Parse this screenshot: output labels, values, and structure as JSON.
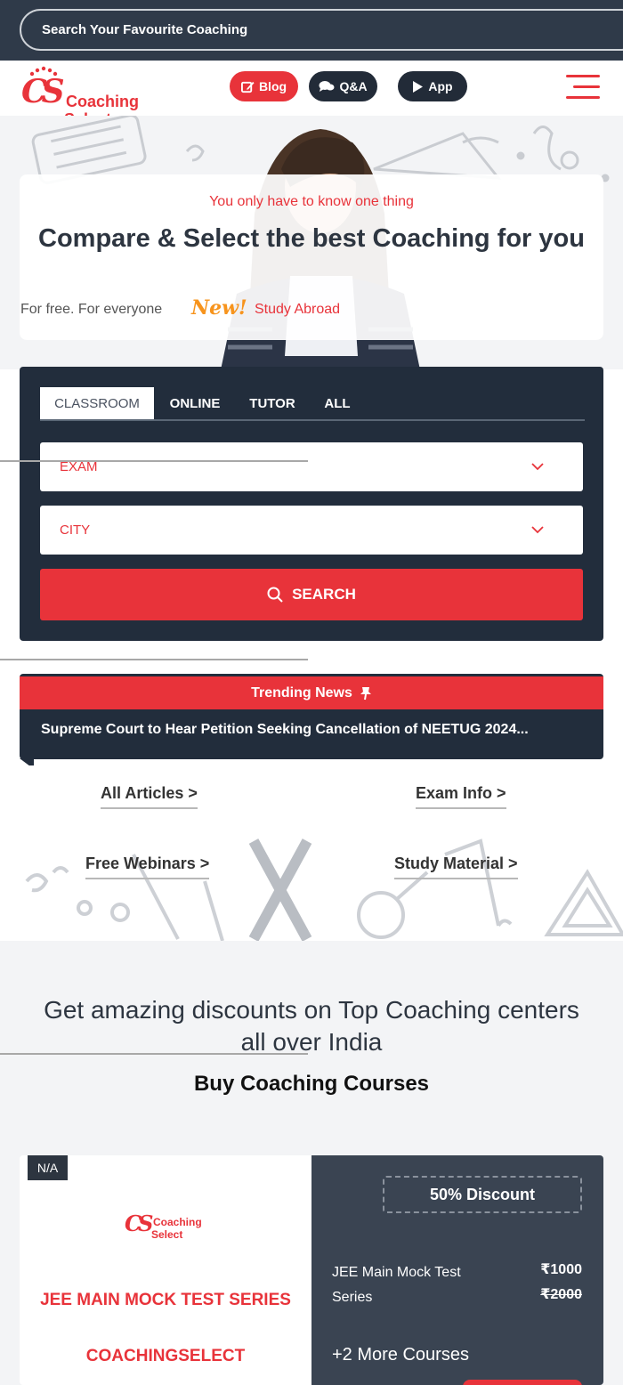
{
  "search": {
    "placeholder": "Search Your Favourite Coaching"
  },
  "logo": {
    "mark": "CS",
    "line1": "Coaching",
    "line2": "Select"
  },
  "header": {
    "blog_label": "Blog",
    "qa_label": "Q&A",
    "app_label": "App"
  },
  "hero": {
    "tagline": "You only have to know one thing",
    "headline": "Compare & Select the best Coaching for you",
    "free_text": "For free. For everyone",
    "new_badge": "New!",
    "abroad_link": "Study Abroad"
  },
  "finder": {
    "tabs": [
      "CLASSROOM",
      "ONLINE",
      "TUTOR",
      "ALL"
    ],
    "exam_select": "EXAM",
    "city_select": "CITY",
    "search_button": "SEARCH"
  },
  "trending": {
    "title": "Trending News",
    "headline": "Supreme Court to Hear Petition Seeking Cancellation of NEETUG 2024..."
  },
  "quick_links": {
    "articles": "All Articles >",
    "exam_info": "Exam Info >",
    "webinars": "Free Webinars >",
    "study_material": "Study Material >"
  },
  "discounts": {
    "title": "Get amazing discounts on Top Coaching centers all over India",
    "subtitle": "Buy Coaching Courses"
  },
  "course_card": {
    "badge": "N/A",
    "logo_line1": "Coaching",
    "logo_line2": "Select",
    "name": "JEE MAIN MOCK TEST SERIES",
    "institute": "COACHINGSELECT",
    "discount": "50% Discount",
    "course_title": "JEE Main Mock Test Series",
    "price": "₹1000",
    "old_price": "₹2000",
    "more_courses": "+2 More Courses"
  },
  "colors": {
    "brand_red": "#e8333a",
    "dark_navy": "#222d3c",
    "slate": "#3a4452",
    "new_orange": "#f7941d"
  },
  "icons": [
    "pencil-square-icon",
    "chat-bubbles-icon",
    "play-icon",
    "hamburger-menu-icon",
    "chevron-down-icon",
    "search-icon",
    "pin-icon"
  ]
}
